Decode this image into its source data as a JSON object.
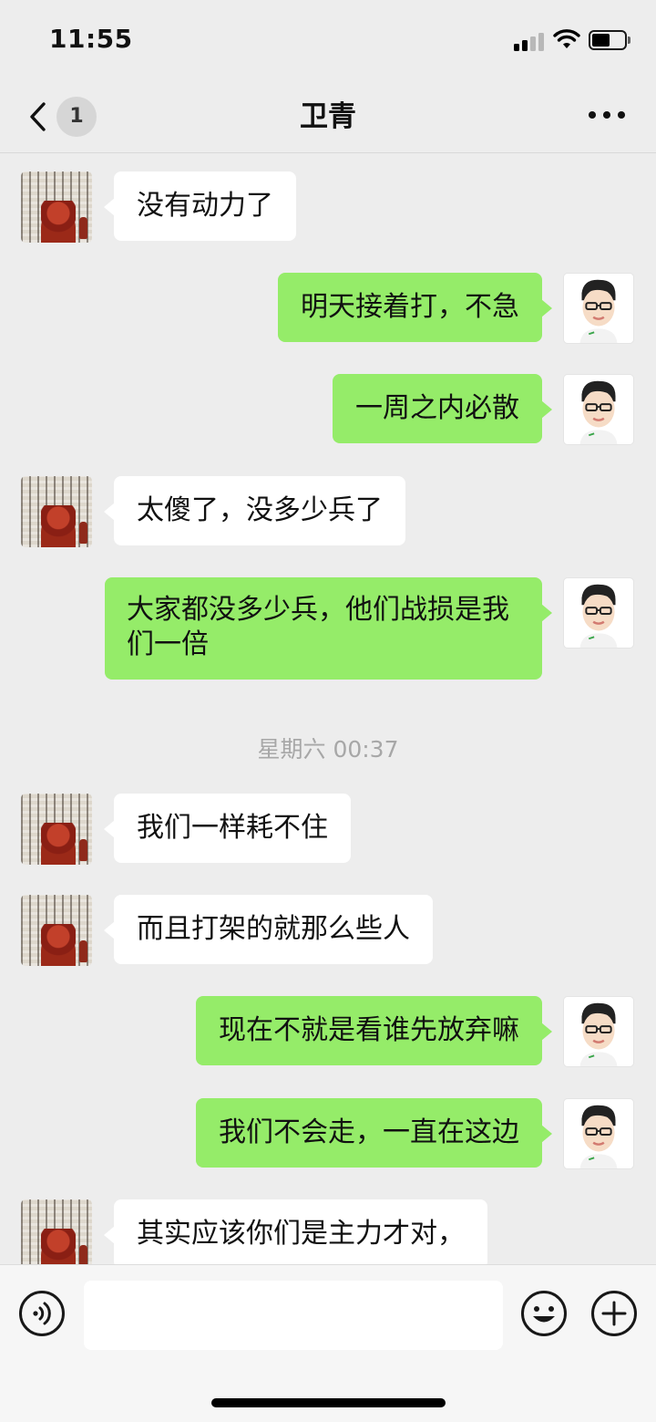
{
  "status_bar": {
    "time": "11:55",
    "signal_icon": "cellular-signal-icon",
    "wifi_icon": "wifi-icon",
    "battery_icon": "battery-icon",
    "battery_level": 0.55
  },
  "header": {
    "back_icon": "chevron-left-icon",
    "unread_count": "1",
    "title": "卫青",
    "more_icon": "ellipsis-icon"
  },
  "messages": [
    {
      "side": "in",
      "text": "没有动力了"
    },
    {
      "side": "out",
      "text": "明天接着打，不急"
    },
    {
      "side": "out",
      "text": "一周之内必散"
    },
    {
      "side": "in",
      "text": "太傻了，没多少兵了"
    },
    {
      "side": "out",
      "text": "大家都没多少兵，他们战损是我们一倍"
    },
    {
      "side": "divider",
      "text": "星期六 00:37"
    },
    {
      "side": "in",
      "text": "我们一样耗不住"
    },
    {
      "side": "in",
      "text": "而且打架的就那么些人"
    },
    {
      "side": "out",
      "text": "现在不就是看谁先放弃嘛"
    },
    {
      "side": "out",
      "text": "我们不会走，一直在这边"
    },
    {
      "side": "in",
      "text": "其实应该你们是主力才对，"
    }
  ],
  "input_bar": {
    "voice_icon": "voice-input-icon",
    "input_value": "",
    "emoji_icon": "emoji-icon",
    "plus_icon": "plus-circle-icon"
  },
  "colors": {
    "background": "#ededed",
    "outgoing_bubble": "#95ec69",
    "incoming_bubble": "#ffffff",
    "timestamp_text": "#a7a7a7"
  }
}
